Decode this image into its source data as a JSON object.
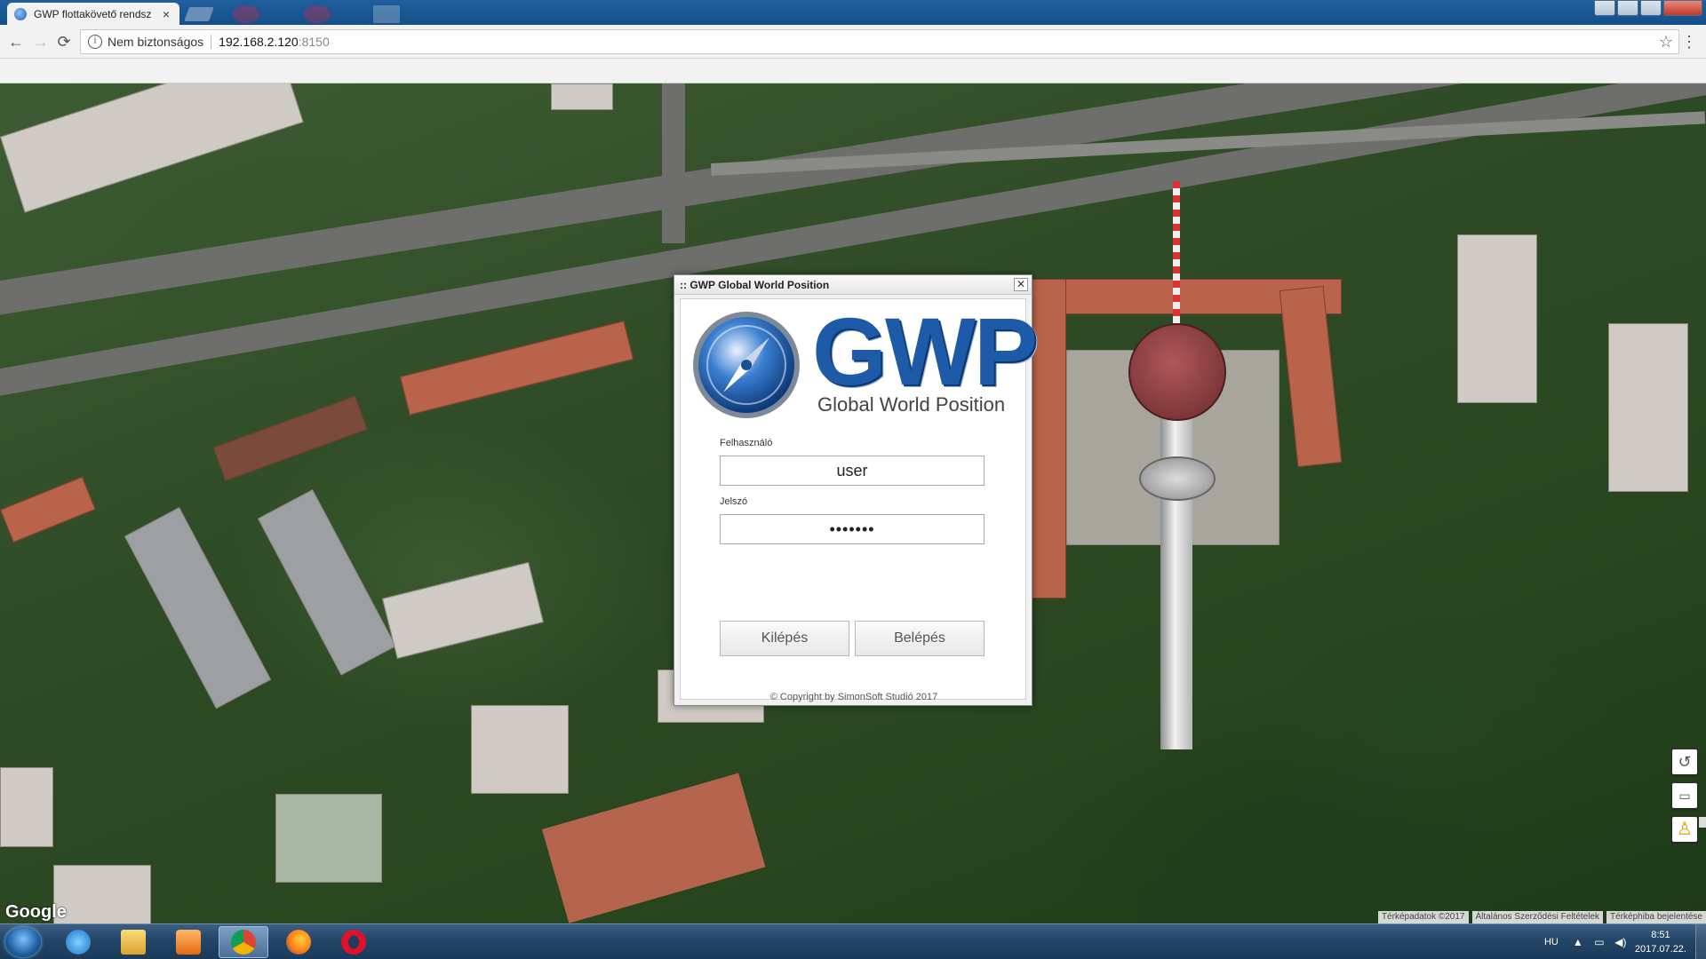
{
  "browser": {
    "tab_title": "GWP flottakövető rendsz",
    "tab_close": "×",
    "security_text": "Nem biztonságos",
    "url_host": "192.168.2.120",
    "url_port": ":8150",
    "back": "←",
    "forward": "→",
    "reload": "⟳",
    "star": "☆",
    "menu": "⋮",
    "info": "i"
  },
  "map": {
    "provider_logo": "Google",
    "attribution": [
      "Térképadatok ©2017",
      "Általános Szerződési Feltételek",
      "Térképhiba bejelentése"
    ],
    "controls": {
      "rotate": "↺",
      "tilt": "▭",
      "pegman": "♙",
      "zoom_in": "+",
      "zoom_out": "−"
    }
  },
  "dialog": {
    "title": ":: GWP Global World Position",
    "close": "✕",
    "logo_text": "GWP",
    "logo_subtitle": "Global World Position",
    "username_label": "Felhasználó",
    "username_value": "user",
    "password_label": "Jelszó",
    "password_value": "•••••••",
    "exit_button": "Kilépés",
    "login_button": "Belépés",
    "copyright": "© Copyright by SimonSoft Studió 2017"
  },
  "taskbar": {
    "apps": [
      "start-orb",
      "internet-explorer",
      "file-explorer",
      "media-player",
      "chrome",
      "firefox",
      "opera"
    ],
    "active_app": "chrome",
    "language": "HU",
    "time": "8:51",
    "date": "2017.07.22."
  }
}
